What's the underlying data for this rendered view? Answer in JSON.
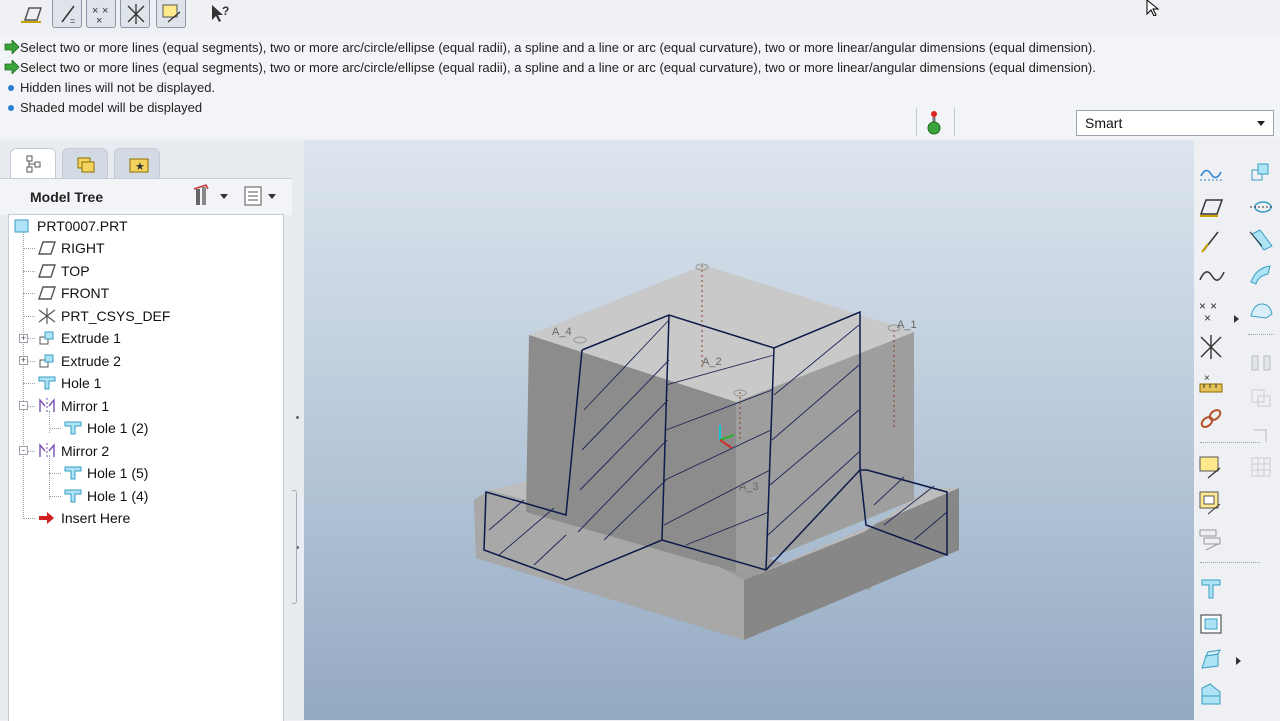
{
  "toolbar": {
    "buttons": [
      {
        "icon": "plane-sketch-icon"
      },
      {
        "icon": "line-equal-icon",
        "pressed": true
      },
      {
        "icon": "point-equal-icon",
        "pressed": true
      },
      {
        "icon": "csys-equal-icon",
        "pressed": true
      },
      {
        "icon": "equal-constraint-icon",
        "pressed": true
      },
      {
        "icon": "context-help-icon"
      }
    ]
  },
  "messages": [
    {
      "type": "prompt",
      "text": "Select two or more lines (equal segments), two or more arc/circle/ellipse (equal radii), a spline and a line or arc (equal curvature), two or more linear/angular dimensions (equal dimension)."
    },
    {
      "type": "prompt",
      "text": "Select two or more lines (equal segments), two or more arc/circle/ellipse (equal radii), a spline and a line or arc (equal curvature), two or more linear/angular dimensions (equal dimension)."
    },
    {
      "type": "info",
      "text": "Hidden lines will not be displayed."
    },
    {
      "type": "info",
      "text": "Shaded model will be displayed"
    }
  ],
  "filter": {
    "selected": "Smart"
  },
  "model_tree": {
    "title": "Model Tree",
    "items": [
      {
        "label": "PRT0007.PRT",
        "icon": "part-icon",
        "level": 0
      },
      {
        "label": "RIGHT",
        "icon": "datum-plane-icon",
        "level": 1
      },
      {
        "label": "TOP",
        "icon": "datum-plane-icon",
        "level": 1
      },
      {
        "label": "FRONT",
        "icon": "datum-plane-icon",
        "level": 1
      },
      {
        "label": "PRT_CSYS_DEF",
        "icon": "csys-icon",
        "level": 1
      },
      {
        "label": "Extrude 1",
        "icon": "extrude-icon",
        "level": 1,
        "expander": "+"
      },
      {
        "label": "Extrude 2",
        "icon": "extrude-icon",
        "level": 1,
        "expander": "+"
      },
      {
        "label": "Hole 1",
        "icon": "hole-icon",
        "level": 1
      },
      {
        "label": "Mirror 1",
        "icon": "mirror-icon",
        "level": 1,
        "expander": "-"
      },
      {
        "label": "Hole 1 (2)",
        "icon": "hole-icon",
        "level": 2
      },
      {
        "label": "Mirror 2",
        "icon": "mirror-icon",
        "level": 1,
        "expander": "-"
      },
      {
        "label": "Hole 1 (5)",
        "icon": "hole-icon",
        "level": 2
      },
      {
        "label": "Hole 1 (4)",
        "icon": "hole-icon",
        "level": 2
      },
      {
        "label": "Insert Here",
        "icon": "insert-here-arrow-icon",
        "level": 1
      }
    ]
  },
  "viewport": {
    "axis_labels": [
      "A_4",
      "A_2",
      "A_1",
      "A_3"
    ],
    "colors": {
      "sketch_line": "#0c1a4a",
      "model_face": "#9a9a9a",
      "background_top": "#dde5ee",
      "background_bottom": "#93a9c2"
    }
  },
  "right_toolbar": {
    "buttons": [
      "datum-display-icon",
      "datum-plane-tool-icon",
      "datum-axis-tool-icon",
      "datum-curve-tool-icon",
      "datum-point-tool-icon",
      "csys-tool-icon",
      "analysis-tool-icon",
      "chain-tool-icon",
      "note-tool-icon",
      "view-manager-icon",
      "layer-tool-icon",
      "extrude-tool-icon",
      "revolve-tool-icon",
      "sweep-tool-icon",
      "blend-tool-icon",
      "boundary-blend-icon",
      "mirror-tool-icon",
      "merge-tool-icon",
      "trim-tool-icon",
      "pattern-tool-icon",
      "hole-tool-icon",
      "shell-tool-icon",
      "draft-tool-icon",
      "rib-tool-icon"
    ]
  }
}
